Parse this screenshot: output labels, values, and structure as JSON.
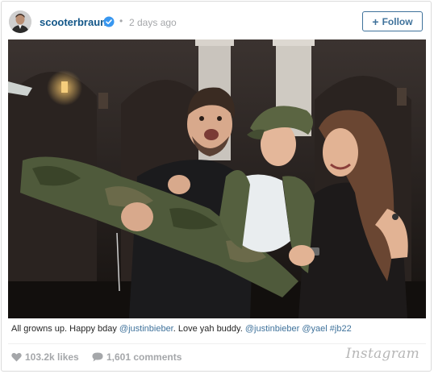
{
  "post": {
    "username": "scooterbraun",
    "verified": true,
    "separator": "•",
    "timestamp": "2 days ago",
    "follow_plus": "+",
    "follow_label": "Follow"
  },
  "caption": {
    "text_1": "All growns up. Happy bday ",
    "mention_1": "@justinbieber",
    "text_2": ". Love yah buddy. ",
    "mention_2": "@justinbieber",
    "space_1": " ",
    "mention_3": "@yael",
    "space_2": " ",
    "hashtag": "#jb22"
  },
  "stats": {
    "likes": "103.2k likes",
    "comments": "1,601 comments"
  },
  "branding": {
    "logo_text": "Instagram"
  },
  "colors": {
    "link": "#3f729b",
    "username": "#125688",
    "verified": "#3897f0",
    "muted": "#a5a7aa"
  },
  "icons": {
    "verified": "verified-badge-icon",
    "likes": "heart-icon",
    "comments": "comment-bubble-icon"
  }
}
